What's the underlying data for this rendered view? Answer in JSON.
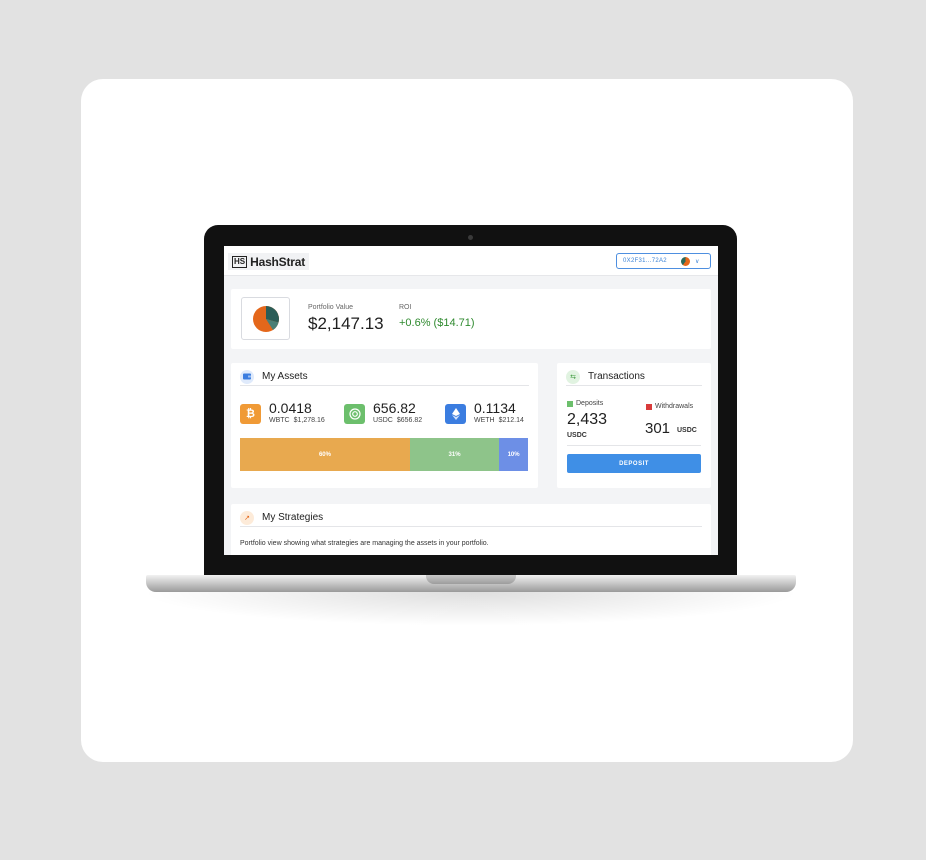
{
  "app": {
    "logo_mark": "HS",
    "logo_text": "HashStrat",
    "wallet_address": "0X2F31...72A2"
  },
  "portfolio": {
    "value_label": "Portfolio Value",
    "value": "$2,147.13",
    "roi_label": "ROI",
    "roi_value": "+0.6% ($14.71)"
  },
  "assets": {
    "title": "My Assets",
    "items": [
      {
        "amount": "0.0418",
        "symbol": "WBTC",
        "usd": "$1,278.16",
        "color": "#f09a36",
        "icon": "bitcoin-icon"
      },
      {
        "amount": "656.82",
        "symbol": "USDC",
        "usd": "$656.82",
        "color": "#6cbf6c",
        "icon": "usdc-icon"
      },
      {
        "amount": "0.1134",
        "symbol": "WETH",
        "usd": "$212.14",
        "color": "#3b7de0",
        "icon": "ethereum-icon"
      }
    ],
    "allocation": [
      {
        "label": "60%",
        "fraction": 0.59,
        "color": "#e8a94f"
      },
      {
        "label": "31%",
        "fraction": 0.31,
        "color": "#8ec48a"
      },
      {
        "label": "10%",
        "fraction": 0.1,
        "color": "#6d8fe6"
      }
    ]
  },
  "transactions": {
    "title": "Transactions",
    "deposits_label": "Deposits",
    "deposits_value": "2,433",
    "deposits_unit": "USDC",
    "withdrawals_label": "Withdrawals",
    "withdrawals_value": "301",
    "withdrawals_unit": "USDC",
    "deposit_button": "DEPOSIT",
    "deposit_color": "#6cbf6c",
    "withdraw_color": "#d93b3b"
  },
  "strategies": {
    "title": "My Strategies",
    "description": "Portfolio view showing what strategies are managing the assets in your portfolio."
  }
}
